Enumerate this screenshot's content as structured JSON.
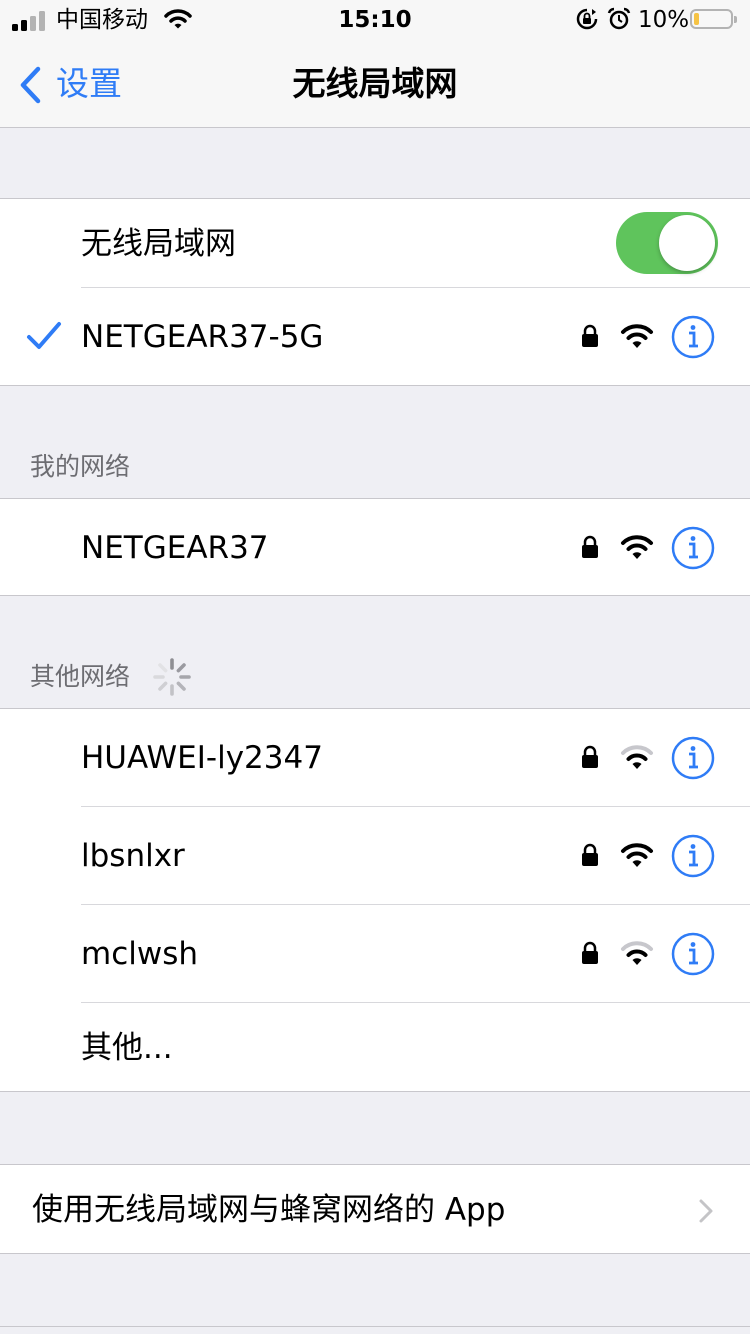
{
  "status_bar": {
    "carrier": "中国移动",
    "time": "15:10",
    "battery_percent": "10%",
    "battery_level": 0.1,
    "battery_color": "#f6c344"
  },
  "nav": {
    "back_label": "设置",
    "title": "无线局域网",
    "accent_color": "#2f7cf6"
  },
  "wifi_toggle": {
    "label": "无线局域网",
    "on": true,
    "on_color": "#5fc45c"
  },
  "connected": {
    "name": "NETGEAR37-5G",
    "secured": true,
    "signal": "full",
    "icons": [
      "checkmark-icon",
      "lock-icon",
      "wifi-signal-icon",
      "info-icon"
    ]
  },
  "my_networks": {
    "header": "我的网络",
    "items": [
      {
        "name": "NETGEAR37",
        "secured": true,
        "signal": "full"
      }
    ]
  },
  "other_networks": {
    "header": "其他网络",
    "loading": true,
    "items": [
      {
        "name": "HUAWEI-ly2347",
        "secured": true,
        "signal": "medium"
      },
      {
        "name": "lbsnlxr",
        "secured": true,
        "signal": "full"
      },
      {
        "name": "mclwsh",
        "secured": true,
        "signal": "medium"
      }
    ],
    "other_label": "其他..."
  },
  "apps_row": {
    "label": "使用无线局域网与蜂窝网络的 App"
  }
}
